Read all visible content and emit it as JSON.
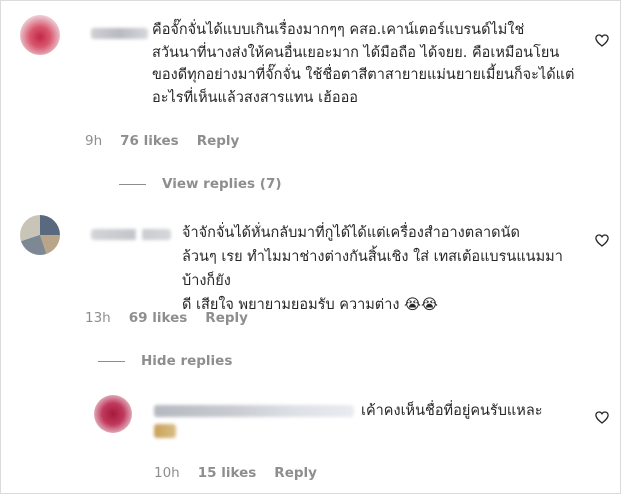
{
  "colors": {
    "text": "#262626",
    "muted": "#8e8e8e",
    "border": "#dbdbdb"
  },
  "comments": [
    {
      "text": "คือจั๊กจั่นได้แบบเกินเรื่องมากๆๆ คสอ.เคาน์เตอร์แบรนด์ไม่ใช่\nสวันนาที่นางส่งให้คนอื่นเยอะมาก ได้มือถือ ได้จยย. คือเหมือนโยน\nของดีทุกอย่างมาที่จั๊กจั่น ใช้ชื่อตาสีตาสายายแม่นยายเมี้ยนก็จะได้แต่\nอะไรที่เห็นแล้วสงสารแทน เฮ้อออ",
      "time": "9h",
      "likes": "76 likes",
      "reply": "Reply",
      "heart_icon": "heart-outline-icon"
    },
    {
      "text": "จ้าจักจั่นได้หั่นกลับมาที่กูได้ได้แต่เครื่องสำอางตลาดนัด\nล้วนๆ เรย ทำไมมาช่างต่างกันสิ้นเชิง ใส่ เทสเต้อแบรนแนมมาบ้างก็ยัง\nดี เสียใจ พยายามยอมรับ ความต่าง 😭😭",
      "time": "13h",
      "likes": "69 likes",
      "reply": "Reply",
      "heart_icon": "heart-outline-icon"
    },
    {
      "text": "เค้าคงเห็นชื่อที่อยู่คนรับแหละ",
      "time": "10h",
      "likes": "15 likes",
      "reply": "Reply",
      "heart_icon": "heart-outline-icon"
    }
  ],
  "view_replies": "View replies (7)",
  "hide_replies": "Hide replies"
}
